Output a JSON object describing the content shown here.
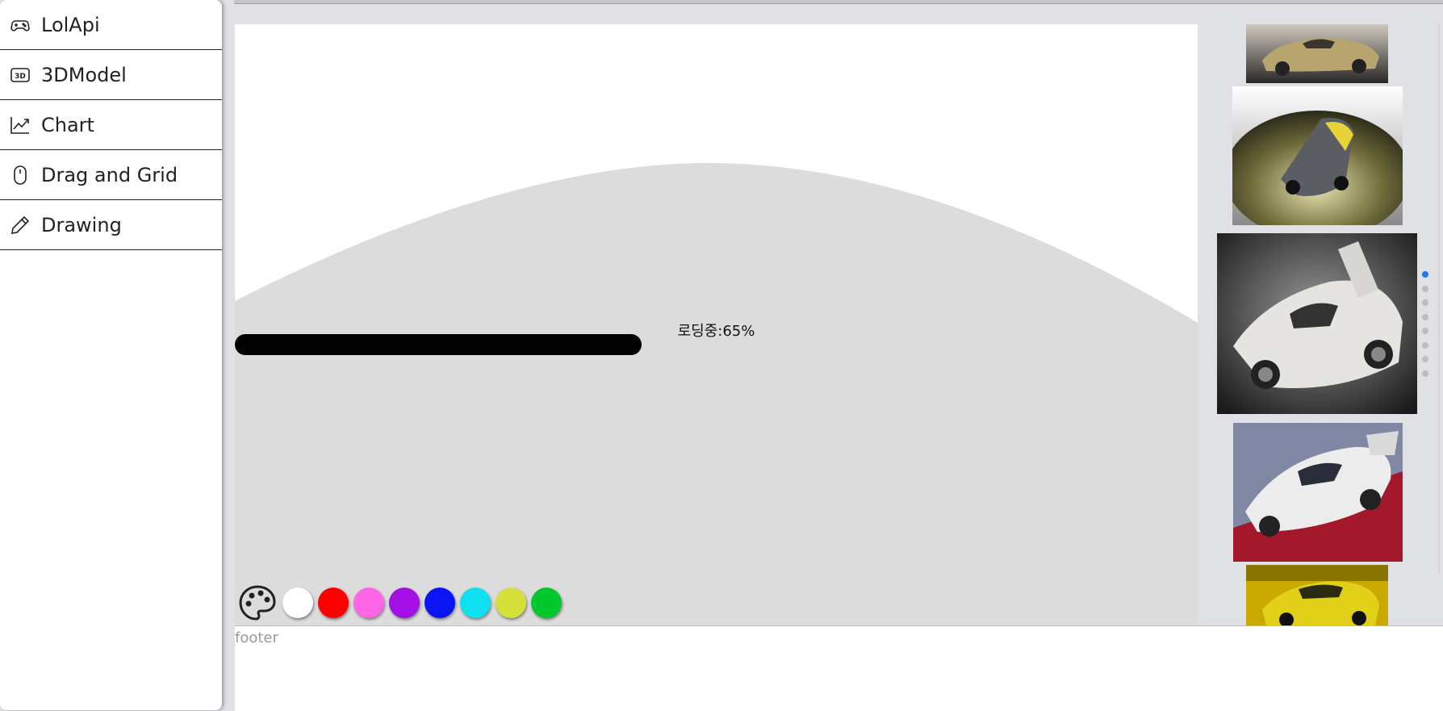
{
  "sidebar": {
    "items": [
      {
        "label": "LolApi",
        "icon": "gamepad-icon"
      },
      {
        "label": "3DModel",
        "icon": "3d-icon"
      },
      {
        "label": "Chart",
        "icon": "line-chart-icon"
      },
      {
        "label": "Drag and Grid",
        "icon": "mouse-icon"
      },
      {
        "label": "Drawing",
        "icon": "pencil-icon"
      }
    ]
  },
  "canvas": {
    "loading_text": "로딩중:65%",
    "progress": 0.65,
    "palette_icon": "palette-icon",
    "colors": [
      "#ffffff",
      "#ff0000",
      "#ff66e6",
      "#a40fe6",
      "#0a14f5",
      "#0fe0f0",
      "#d6e03a",
      "#00c82d"
    ]
  },
  "gallery": {
    "images": [
      "car-thumbnail-gold-roadster",
      "car-thumbnail-yellow-racer",
      "car-thumbnail-white-supercar",
      "car-thumbnail-white-race-car",
      "car-thumbnail-yellow-sports-car"
    ],
    "page_count": 8,
    "active_page": 1
  },
  "footer": {
    "text": "footer"
  }
}
